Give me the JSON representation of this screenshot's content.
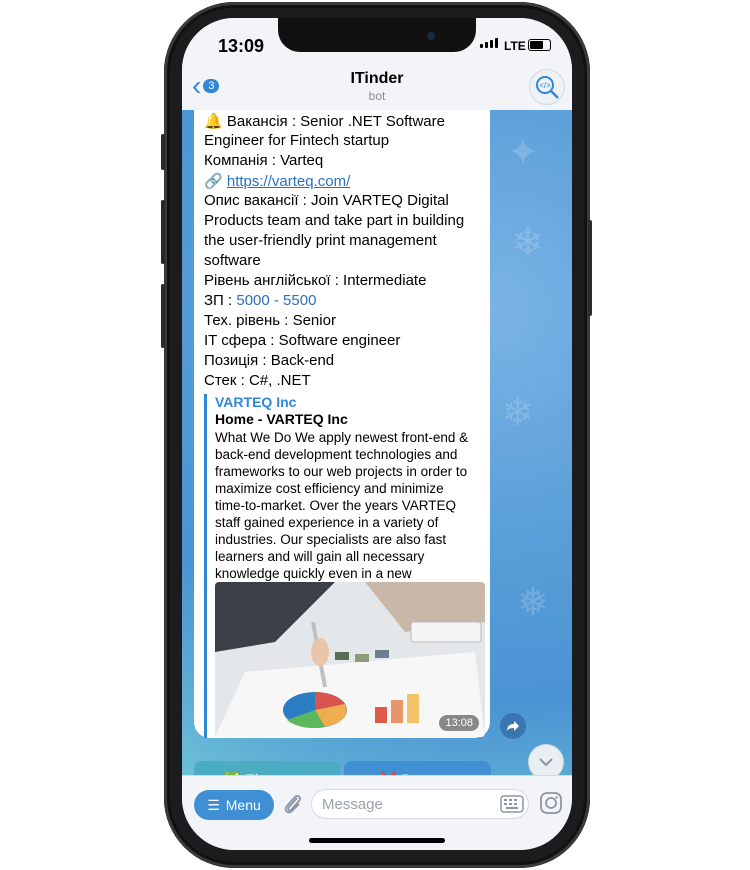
{
  "status": {
    "time": "13:09",
    "network": "LTE"
  },
  "header": {
    "back_count": "3",
    "title": "ITinder",
    "subtitle": "bot"
  },
  "message": {
    "lines": [
      "🔔 Вакансія : Senior .NET Software",
      "Engineer for Fintech startup",
      "Компанія : Varteq",
      "🔗",
      "Опис вакансії : Join VARTEQ Digital",
      "Products team and take part in building",
      "the user-friendly print management",
      "software",
      "Рівень англійської : Intermediate",
      "ЗП :",
      "Тех. рівень : Senior",
      "IT сфера : Software engineer",
      "Позиція : Back-end",
      "Стек : C#, .NET"
    ],
    "link": "https://varteq.com/",
    "salary": "5000 - 5500"
  },
  "preview": {
    "site": "VARTEQ Inc",
    "title": "Home - VARTEQ Inc",
    "description": [
      "What We Do We apply newest front-end &",
      "back-end development technologies and",
      "frameworks to our web projects in order to",
      "maximize cost efficiency and minimize",
      "time-to-market. Over the years VARTEQ",
      "staff gained experience in a variety of",
      "industries. Our specialists are also fast",
      "learners and will gain all necessary",
      "knowledge quickly even in a new"
    ],
    "time": "13:08"
  },
  "keyboard": {
    "approve": "✅ Підходить",
    "reject": "❌ Реджект"
  },
  "input": {
    "menu": "Menu",
    "placeholder": "Message"
  },
  "colors": {
    "accent": "#2f87d8",
    "link": "#2a6fc2"
  }
}
